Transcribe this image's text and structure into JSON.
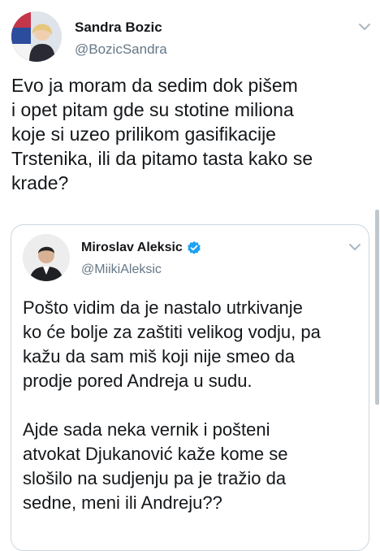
{
  "tweet": {
    "author_name": "Sandra Bozic",
    "author_handle": "@BozicSandra",
    "avatar_icon": "profile-photo",
    "menu_icon": "chevron-down-icon",
    "text": "Evo ja moram da sedim dok pišem\ni opet pitam gde su stotine miliona\nkoje si uzeo prilikom gasifikacije\nTrstenika, ili da pitamo tasta kako se\nkrade?"
  },
  "quoted_tweet": {
    "author_name": "Miroslav Aleksic",
    "author_handle": "@MiikiAleksic",
    "verified": true,
    "verified_icon": "verified-badge-icon",
    "menu_icon": "chevron-down-icon",
    "paragraph_1": "Pošto vidim da je nastalo utrkivanje\nko će bolje za zaštiti velikog vodju, pa\nkažu da sam miš koji nije smeo da\nprodje pored Andreja u sudu.",
    "paragraph_2": "Ajde sada neka vernik i pošteni\natvokat Djukanović kaže kome se\nslošilo na sudjenju pa je tražio da\nsedne, meni ili Andreju??"
  },
  "colors": {
    "text": "#14171a",
    "secondary": "#657786",
    "border": "#ccd6dd",
    "verified": "#1da1f2"
  }
}
